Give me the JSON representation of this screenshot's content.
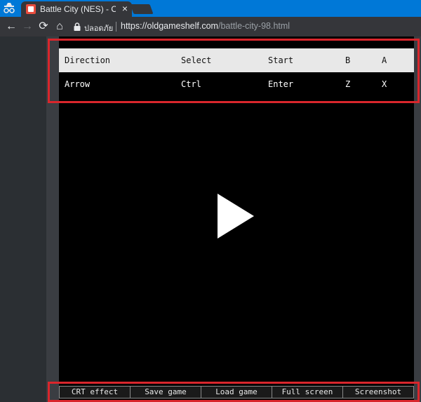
{
  "browser": {
    "tab": {
      "title": "Battle City (NES) - Online",
      "close": "×"
    },
    "nav": {
      "back": "←",
      "forward": "→",
      "reload": "⟳",
      "home": "⌂"
    },
    "address": {
      "secure_label": "ปลอดภัย",
      "url_scheme_host": "https://oldgameshelf.com",
      "url_path": "/battle-city-98.html"
    }
  },
  "controls_table": {
    "headers": [
      "Direction",
      "Select",
      "Start",
      "B",
      "A"
    ],
    "row": [
      "Arrow",
      "Ctrl",
      "Enter",
      "Z",
      "X"
    ]
  },
  "bottom_buttons": [
    "CRT effect",
    "Save game",
    "Load game",
    "Full screen",
    "Screenshot"
  ],
  "colors": {
    "highlight": "#d9262c",
    "tabstrip": "#0078d7"
  }
}
